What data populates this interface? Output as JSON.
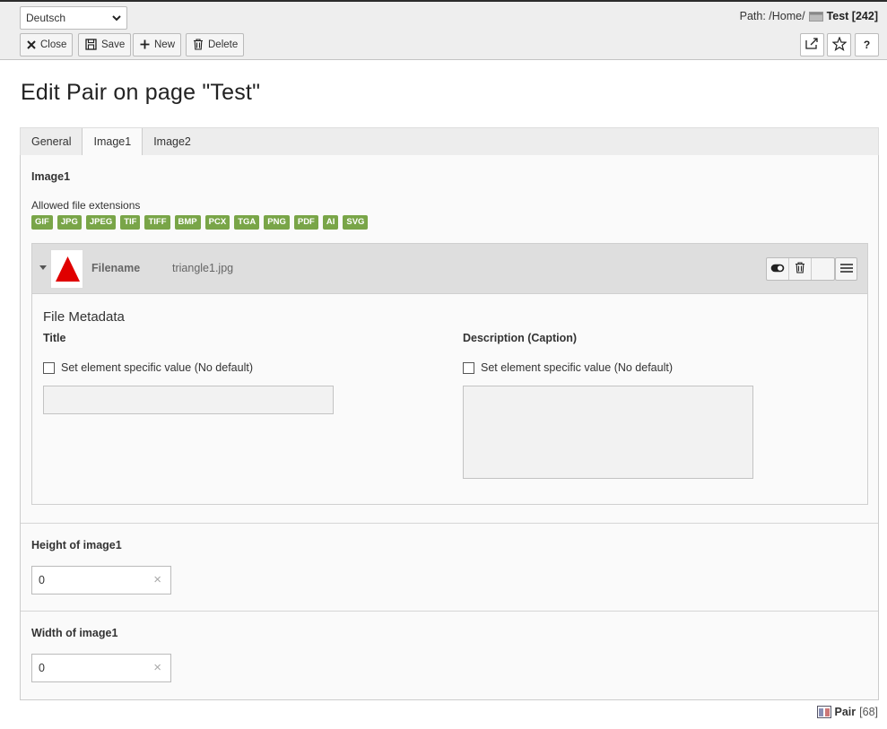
{
  "header": {
    "language": "Deutsch",
    "path_prefix": "Path: /Home/",
    "page_title": "Test [242]",
    "buttons": {
      "close": "Close",
      "save": "Save",
      "new": "New",
      "delete": "Delete",
      "help": "?"
    }
  },
  "main": {
    "title": "Edit Pair on page \"Test\"",
    "tabs": [
      {
        "label": "General",
        "active": false
      },
      {
        "label": "Image1",
        "active": true
      },
      {
        "label": "Image2",
        "active": false
      }
    ],
    "image_section": {
      "heading": "Image1",
      "allowed_label": "Allowed file extensions",
      "extensions": [
        "GIF",
        "JPG",
        "JPEG",
        "TIF",
        "TIFF",
        "BMP",
        "PCX",
        "TGA",
        "PNG",
        "PDF",
        "AI",
        "SVG"
      ]
    },
    "file": {
      "filename_label": "Filename",
      "filename": "triangle1.jpg",
      "metadata_title": "File Metadata",
      "title_label": "Title",
      "title_checkbox": "Set element specific value (No default)",
      "description_label": "Description (Caption)",
      "description_checkbox": "Set element specific value (No default)"
    },
    "height": {
      "label": "Height of image1",
      "value": "0"
    },
    "width": {
      "label": "Width of image1",
      "value": "0"
    }
  },
  "footer": {
    "record_type": "Pair",
    "record_uid": "[68]"
  },
  "colors": {
    "extension_badge": "#79a548",
    "triangle": "#e00000"
  }
}
